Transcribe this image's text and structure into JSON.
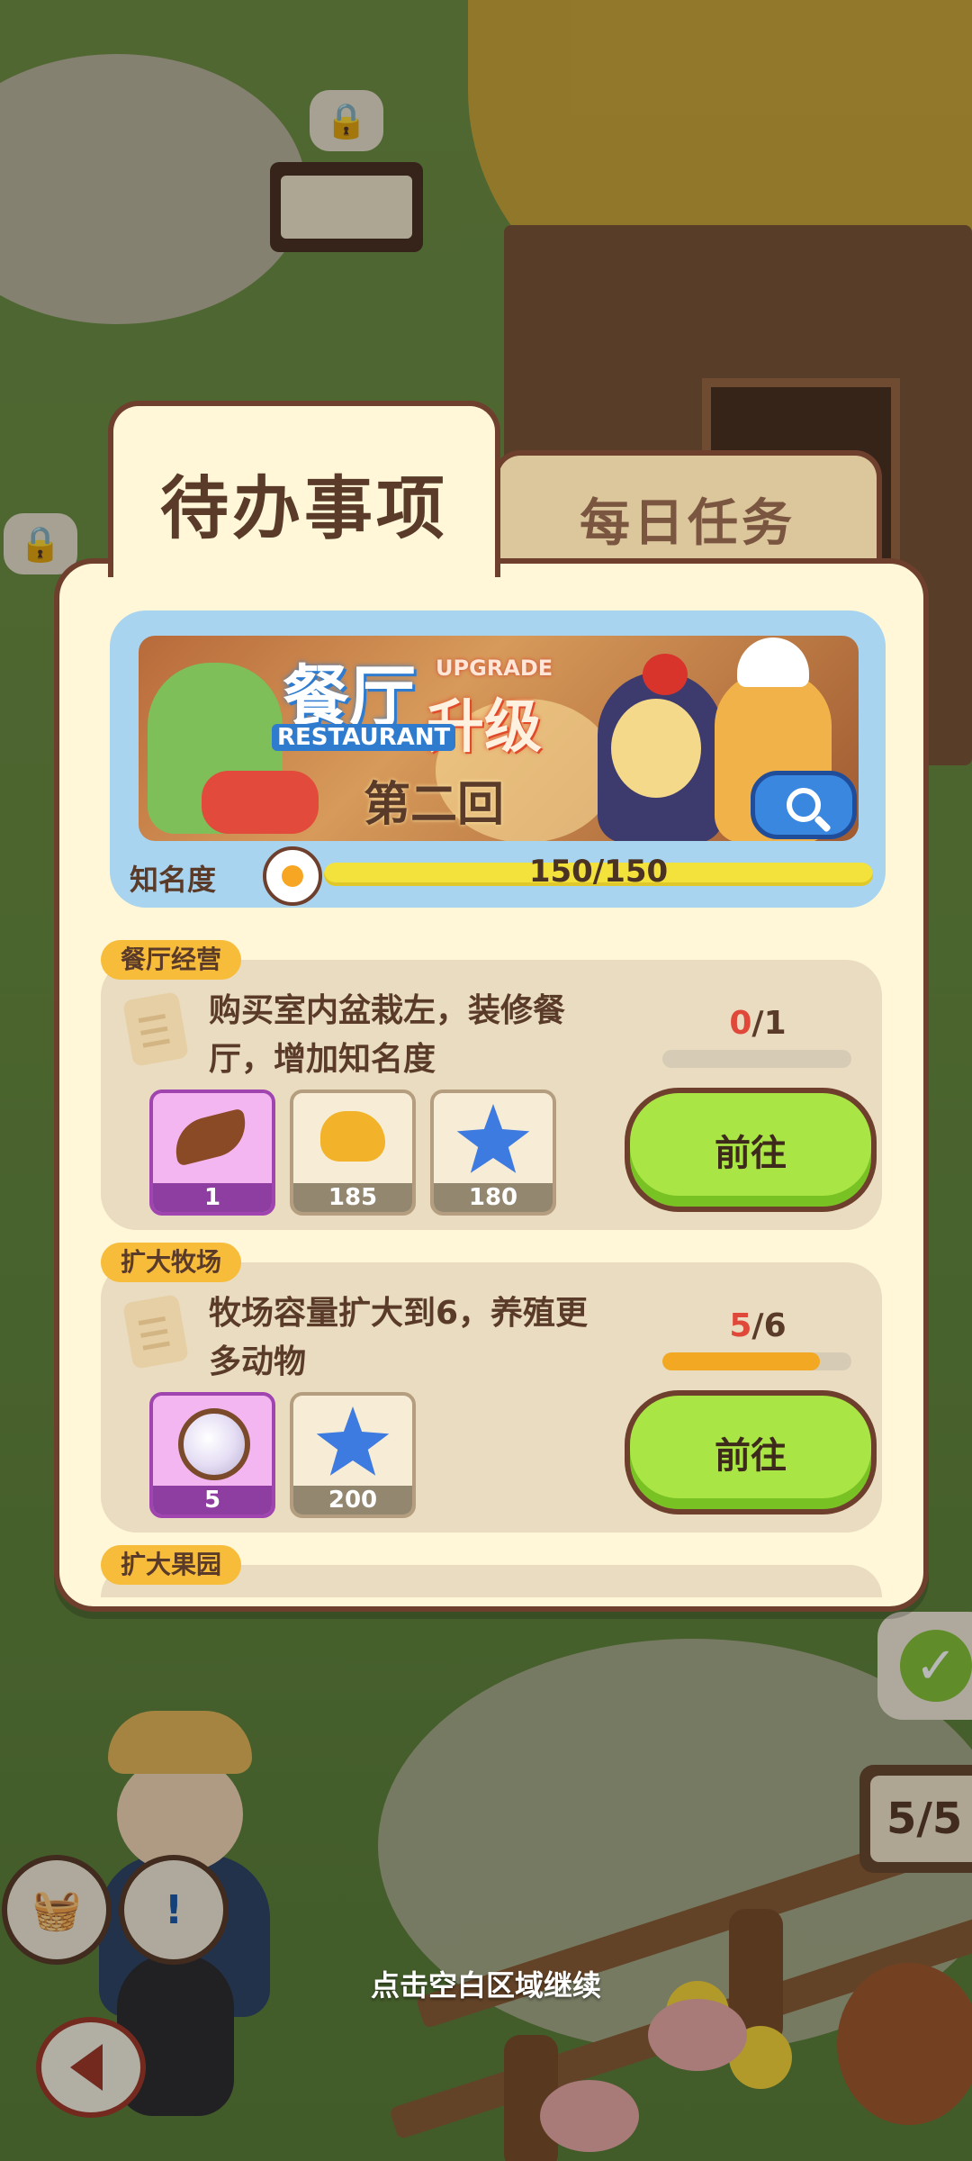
{
  "tabs": {
    "active_label": "待办事项",
    "inactive_label": "每日任务"
  },
  "banner": {
    "title_zh_part1": "餐厅",
    "title_zh_part2": "升级",
    "title_en_top": "UPGRADE",
    "title_en_bottom": "RESTAURANT",
    "subtitle": "第二回",
    "search_icon": "search-icon"
  },
  "fame": {
    "label": "知名度",
    "progress_text": "150/150",
    "fraction": 1.0
  },
  "tasks": [
    {
      "tag": "餐厅经营",
      "description": "购买室内盆栽左，装修餐厅，增加知名度",
      "progress_current": "0",
      "progress_total": "/1",
      "fraction": 0.0,
      "button_label": "前往",
      "rewards": [
        {
          "icon": "leaf-icon",
          "qty": "1",
          "style": "purple"
        },
        {
          "icon": "bird-icon",
          "qty": "185",
          "style": "beige"
        },
        {
          "icon": "star-icon",
          "qty": "180",
          "style": "beige"
        }
      ]
    },
    {
      "tag": "扩大牧场",
      "description": "牧场容量扩大到6，养殖更多动物",
      "progress_current": "5",
      "progress_total": "/6",
      "fraction": 0.833,
      "button_label": "前往",
      "rewards": [
        {
          "icon": "pearl-icon",
          "qty": "5",
          "style": "purple"
        },
        {
          "icon": "star-icon",
          "qty": "200",
          "style": "beige"
        }
      ]
    },
    {
      "tag": "扩大果园"
    }
  ],
  "background": {
    "count_sign": "5/5",
    "hint": "点击空白区域继续"
  },
  "colors": {
    "panel_bg": "#fff7d8",
    "panel_border": "#6e3f2c",
    "go_button": "#a9e544",
    "tag_bg": "#f7bc3a",
    "progress_fill": "#f2a822",
    "fame_bar": "#f4e23c"
  }
}
